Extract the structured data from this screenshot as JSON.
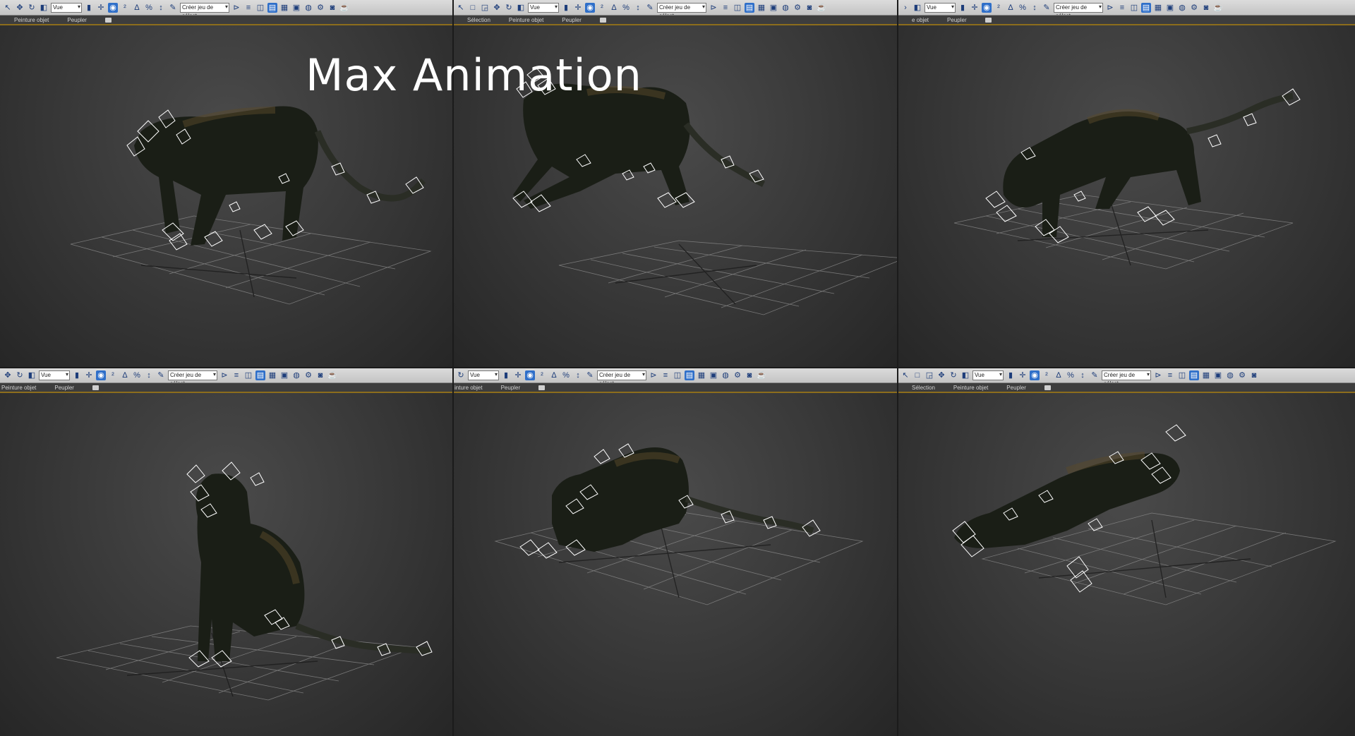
{
  "title": "Max Animation",
  "toolbar": {
    "view_value": "Vue",
    "selection_set_placeholder": "Créer jeu de sélect."
  },
  "subbar": {
    "selection": "Sélection",
    "object_paint": "Peinture objet",
    "populate": "Peupler"
  },
  "colors": {
    "viewport_bg": "#3a3a3a",
    "toolbar_bg": "#c8c8c8",
    "subbar_bg": "#3d3d3d",
    "accent_line": "#8c6d1c",
    "grid_line": "#8e8e8e",
    "bone_helpers": "#ffffff",
    "panther_body": "#1a1e16"
  },
  "viewports": [
    {
      "pose": "walking",
      "subbar_items": [
        "Peinture objet",
        "Peupler"
      ]
    },
    {
      "pose": "leaping",
      "subbar_items": [
        "Sélection",
        "Peinture objet",
        "Peupler"
      ]
    },
    {
      "pose": "stalking",
      "subbar_items": [
        "e objet",
        "Peupler"
      ]
    },
    {
      "pose": "sitting",
      "subbar_items": [
        "Peinture objet",
        "Peupler"
      ]
    },
    {
      "pose": "crouching",
      "subbar_items": [
        "inture objet",
        "Peupler"
      ]
    },
    {
      "pose": "lying",
      "subbar_items": [
        "Sélection",
        "Peinture objet",
        "Peupler"
      ]
    }
  ],
  "icons": [
    "select-arrow-icon",
    "move-icon",
    "rotate-icon",
    "scale-icon",
    "select-region-icon",
    "snap-2d-icon",
    "angle-snap-icon",
    "percent-snap-icon",
    "spinner-snap-icon",
    "edit-named-sel-icon",
    "mirror-icon",
    "align-icon",
    "layer-icon",
    "scene-explorer-icon",
    "graph-editor-icon",
    "schematic-icon",
    "material-editor-icon",
    "render-setup-icon",
    "render-frame-icon",
    "render-icon",
    "teapot-icon"
  ]
}
